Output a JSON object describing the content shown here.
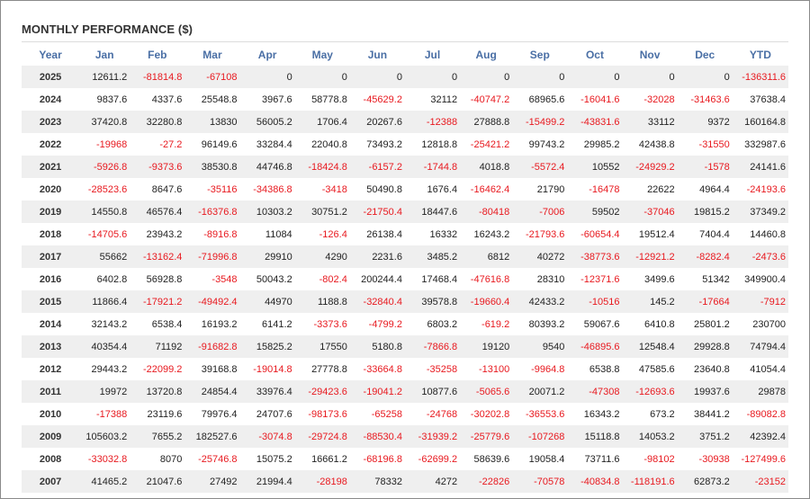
{
  "title": "MONTHLY PERFORMANCE ($)",
  "colors": {
    "header": "#4a6fa5",
    "negative": "#e8191f",
    "positive": "#222222",
    "stripe": "#efefef"
  },
  "chart_data": {
    "type": "table",
    "title": "MONTHLY PERFORMANCE ($)",
    "columns": [
      "Year",
      "Jan",
      "Feb",
      "Mar",
      "Apr",
      "May",
      "Jun",
      "Jul",
      "Aug",
      "Sep",
      "Oct",
      "Nov",
      "Dec",
      "YTD"
    ],
    "rows": [
      [
        "2025",
        "12611.2",
        "-81814.8",
        "-67108",
        "0",
        "0",
        "0",
        "0",
        "0",
        "0",
        "0",
        "0",
        "0",
        "-136311.6"
      ],
      [
        "2024",
        "9837.6",
        "4337.6",
        "25548.8",
        "3967.6",
        "58778.8",
        "-45629.2",
        "32112",
        "-40747.2",
        "68965.6",
        "-16041.6",
        "-32028",
        "-31463.6",
        "37638.4"
      ],
      [
        "2023",
        "37420.8",
        "32280.8",
        "13830",
        "56005.2",
        "1706.4",
        "20267.6",
        "-12388",
        "27888.8",
        "-15499.2",
        "-43831.6",
        "33112",
        "9372",
        "160164.8"
      ],
      [
        "2022",
        "-19968",
        "-27.2",
        "96149.6",
        "33284.4",
        "22040.8",
        "73493.2",
        "12818.8",
        "-25421.2",
        "99743.2",
        "29985.2",
        "42438.8",
        "-31550",
        "332987.6"
      ],
      [
        "2021",
        "-5926.8",
        "-9373.6",
        "38530.8",
        "44746.8",
        "-18424.8",
        "-6157.2",
        "-1744.8",
        "4018.8",
        "-5572.4",
        "10552",
        "-24929.2",
        "-1578",
        "24141.6"
      ],
      [
        "2020",
        "-28523.6",
        "8647.6",
        "-35116",
        "-34386.8",
        "-3418",
        "50490.8",
        "1676.4",
        "-16462.4",
        "21790",
        "-16478",
        "22622",
        "4964.4",
        "-24193.6"
      ],
      [
        "2019",
        "14550.8",
        "46576.4",
        "-16376.8",
        "10303.2",
        "30751.2",
        "-21750.4",
        "18447.6",
        "-80418",
        "-7006",
        "59502",
        "-37046",
        "19815.2",
        "37349.2"
      ],
      [
        "2018",
        "-14705.6",
        "23943.2",
        "-8916.8",
        "11084",
        "-126.4",
        "26138.4",
        "16332",
        "16243.2",
        "-21793.6",
        "-60654.4",
        "19512.4",
        "7404.4",
        "14460.8"
      ],
      [
        "2017",
        "55662",
        "-13162.4",
        "-71996.8",
        "29910",
        "4290",
        "2231.6",
        "3485.2",
        "6812",
        "40272",
        "-38773.6",
        "-12921.2",
        "-8282.4",
        "-2473.6"
      ],
      [
        "2016",
        "6402.8",
        "56928.8",
        "-3548",
        "50043.2",
        "-802.4",
        "200244.4",
        "17468.4",
        "-47616.8",
        "28310",
        "-12371.6",
        "3499.6",
        "51342",
        "349900.4"
      ],
      [
        "2015",
        "11866.4",
        "-17921.2",
        "-49492.4",
        "44970",
        "1188.8",
        "-32840.4",
        "39578.8",
        "-19660.4",
        "42433.2",
        "-10516",
        "145.2",
        "-17664",
        "-7912"
      ],
      [
        "2014",
        "32143.2",
        "6538.4",
        "16193.2",
        "6141.2",
        "-3373.6",
        "-4799.2",
        "6803.2",
        "-619.2",
        "80393.2",
        "59067.6",
        "6410.8",
        "25801.2",
        "230700"
      ],
      [
        "2013",
        "40354.4",
        "71192",
        "-91682.8",
        "15825.2",
        "17550",
        "5180.8",
        "-7866.8",
        "19120",
        "9540",
        "-46895.6",
        "12548.4",
        "29928.8",
        "74794.4"
      ],
      [
        "2012",
        "29443.2",
        "-22099.2",
        "39168.8",
        "-19014.8",
        "27778.8",
        "-33664.8",
        "-35258",
        "-13100",
        "-9964.8",
        "6538.8",
        "47585.6",
        "23640.8",
        "41054.4"
      ],
      [
        "2011",
        "19972",
        "13720.8",
        "24854.4",
        "33976.4",
        "-29423.6",
        "-19041.2",
        "10877.6",
        "-5065.6",
        "20071.2",
        "-47308",
        "-12693.6",
        "19937.6",
        "29878"
      ],
      [
        "2010",
        "-17388",
        "23119.6",
        "79976.4",
        "24707.6",
        "-98173.6",
        "-65258",
        "-24768",
        "-30202.8",
        "-36553.6",
        "16343.2",
        "673.2",
        "38441.2",
        "-89082.8"
      ],
      [
        "2009",
        "105603.2",
        "7655.2",
        "182527.6",
        "-3074.8",
        "-29724.8",
        "-88530.4",
        "-31939.2",
        "-25779.6",
        "-107268",
        "15118.8",
        "14053.2",
        "3751.2",
        "42392.4"
      ],
      [
        "2008",
        "-33032.8",
        "8070",
        "-25746.8",
        "15075.2",
        "16661.2",
        "-68196.8",
        "-62699.2",
        "58639.6",
        "19058.4",
        "73711.6",
        "-98102",
        "-30938",
        "-127499.6"
      ],
      [
        "2007",
        "41465.2",
        "21047.6",
        "27492",
        "21994.4",
        "-28198",
        "78332",
        "4272",
        "-22826",
        "-70578",
        "-40834.8",
        "-118191.6",
        "62873.2",
        "-23152"
      ]
    ]
  }
}
